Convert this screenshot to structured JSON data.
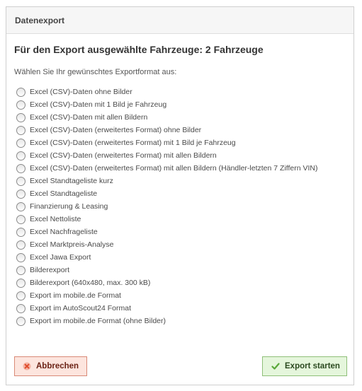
{
  "dialog": {
    "title": "Datenexport",
    "heading": "Für den Export ausgewählte Fahrzeuge: 2 Fahrzeuge",
    "instruction": "Wählen Sie Ihr gewünschtes Exportformat aus:",
    "options": [
      "Excel (CSV)-Daten ohne Bilder",
      "Excel (CSV)-Daten mit 1 Bild je Fahrzeug",
      "Excel (CSV)-Daten mit allen Bildern",
      "Excel (CSV)-Daten (erweitertes Format) ohne Bilder",
      "Excel (CSV)-Daten (erweitertes Format) mit 1 Bild je Fahrzeug",
      "Excel (CSV)-Daten (erweitertes Format) mit allen Bildern",
      "Excel (CSV)-Daten (erweitertes Format) mit allen Bildern (Händler-letzten 7 Ziffern VIN)",
      "Excel Standtageliste kurz",
      "Excel Standtageliste",
      "Finanzierung & Leasing",
      "Excel Nettoliste",
      "Excel Nachfrageliste",
      "Excel Marktpreis-Analyse",
      "Excel Jawa Export",
      "Bilderexport",
      "Bilderexport (640x480, max. 300 kB)",
      "Export im mobile.de Format",
      "Export im AutoScout24 Format",
      "Export im mobile.de Format (ohne Bilder)"
    ],
    "cancel_label": "Abbrechen",
    "export_label": "Export starten"
  },
  "icons": {
    "cancel": "x-icon",
    "export": "checkmark-icon"
  },
  "colors": {
    "cancel_bg": "#fde5de",
    "export_bg": "#e5f6dc",
    "cancel_icon": "#e04a2a",
    "export_icon": "#5aa83a"
  }
}
